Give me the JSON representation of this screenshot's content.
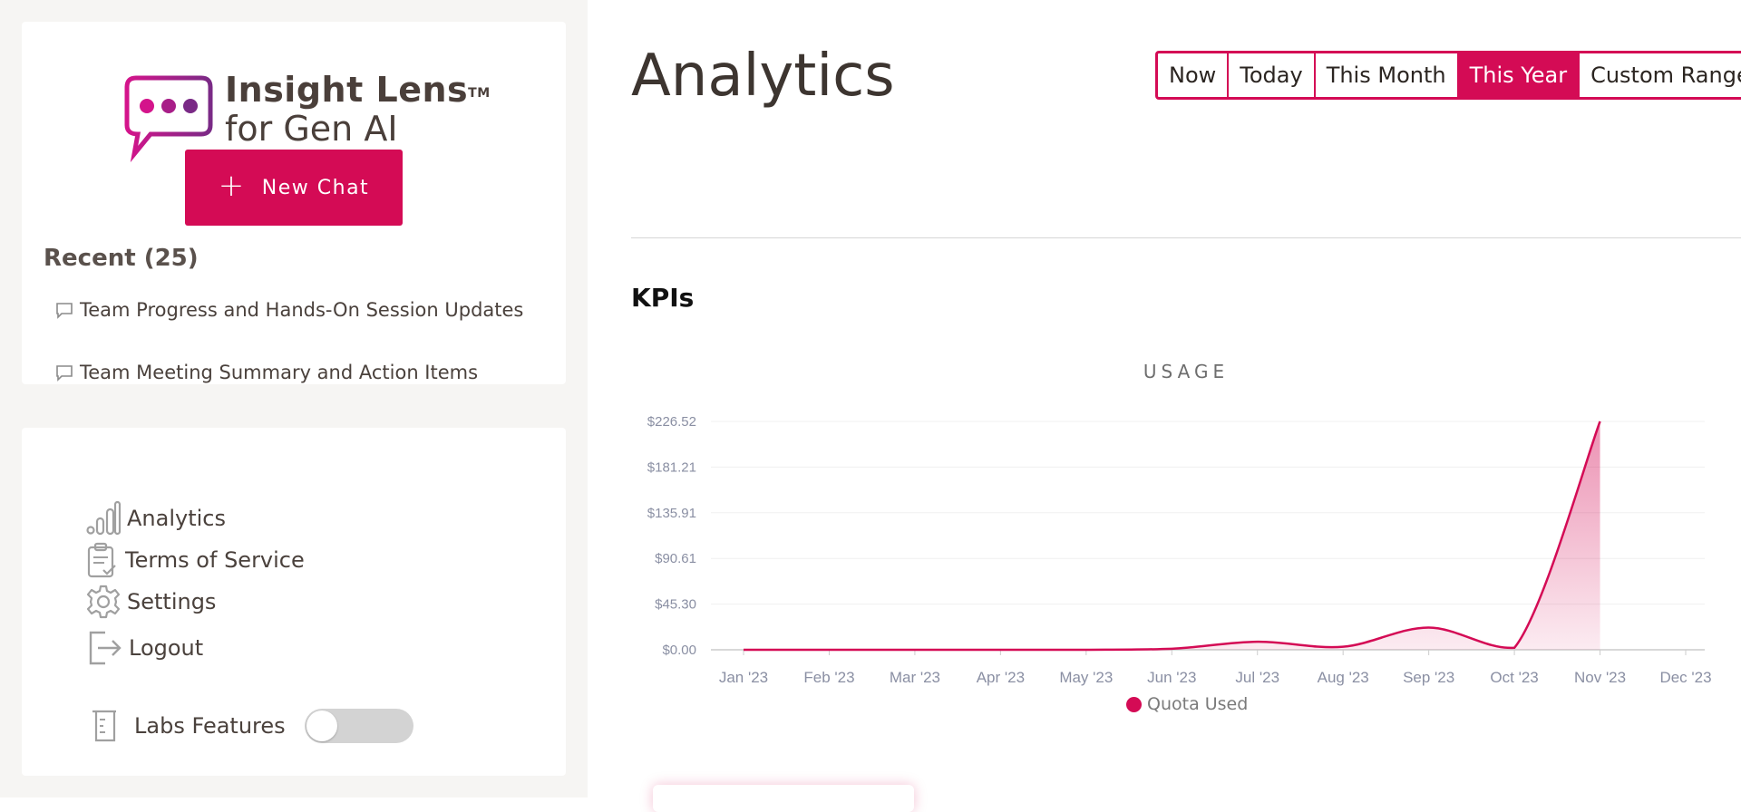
{
  "app": {
    "logo_line1": "Insight Lens",
    "logo_tm": "TM",
    "logo_line2": "for Gen AI"
  },
  "sidebar": {
    "new_chat_label": "New Chat",
    "recent_title": "Recent (25)",
    "recent_items": [
      {
        "label": "Team Progress and Hands-On Session Updates"
      },
      {
        "label": "Team Meeting Summary and Action Items"
      }
    ],
    "nav": [
      {
        "label": "Analytics",
        "icon": "bar-chart-icon"
      },
      {
        "label": "Terms of Service",
        "icon": "clipboard-check-icon"
      },
      {
        "label": "Settings",
        "icon": "gear-icon"
      },
      {
        "label": "Logout",
        "icon": "logout-icon"
      }
    ],
    "labs": {
      "label": "Labs Features",
      "enabled": false,
      "icon": "beaker-icon"
    }
  },
  "main": {
    "title": "Analytics",
    "ranges": [
      {
        "label": "Now",
        "active": false
      },
      {
        "label": "Today",
        "active": false
      },
      {
        "label": "This Month",
        "active": false
      },
      {
        "label": "This Year",
        "active": true
      },
      {
        "label": "Custom Range",
        "active": false
      }
    ],
    "kpi_title": "KPIs"
  },
  "colors": {
    "accent": "#d40b55",
    "sidebar_bg": "#f6f5f3",
    "text": "#3d3530"
  },
  "chart_data": {
    "type": "area",
    "title": "USAGE",
    "xlabel": "",
    "ylabel": "",
    "categories": [
      "Jan '23",
      "Feb '23",
      "Mar '23",
      "Apr '23",
      "May '23",
      "Jun '23",
      "Jul '23",
      "Aug '23",
      "Sep '23",
      "Oct '23",
      "Nov '23",
      "Dec '23"
    ],
    "y_ticks": [
      "$0.00",
      "$45.30",
      "$90.61",
      "$135.91",
      "$181.21",
      "$226.52"
    ],
    "ylim": [
      0,
      226.52
    ],
    "series": [
      {
        "name": "Quota Used",
        "color": "#d40b55",
        "x": [
          "Jan '23",
          "Feb '23",
          "Mar '23",
          "Apr '23",
          "May '23",
          "Jun '23",
          "Jul '23",
          "Aug '23",
          "Sep '23",
          "Oct '23",
          "Nov '23"
        ],
        "values": [
          0,
          0,
          0,
          0,
          0,
          1,
          8,
          3,
          22,
          2,
          226.52
        ]
      }
    ],
    "legend": "bottom-center",
    "grid": true
  }
}
